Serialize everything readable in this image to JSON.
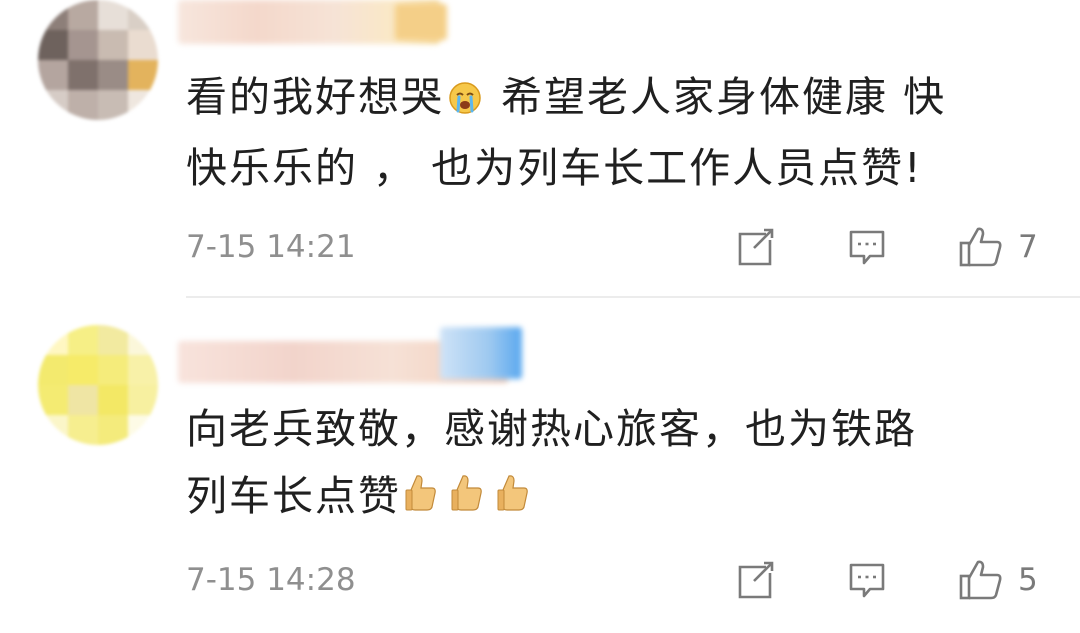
{
  "comments": [
    {
      "text_lines": [
        "看的我好想哭",
        " 希望老人家身体健康 快",
        "快乐乐的 ， 也为列车长工作人员点赞!"
      ],
      "emoji": "crying-face",
      "timestamp": "7-15 14:21",
      "likes": "7"
    },
    {
      "text_lines": [
        "向老兵致敬，感谢热心旅客，也为铁路",
        "列车长点赞"
      ],
      "emoji": "thumbs-up x3",
      "timestamp": "7-15 14:28",
      "likes": "5"
    }
  ],
  "icons": {
    "repost": "repost-icon",
    "reply": "comment-icon",
    "like": "thumbs-up-icon"
  },
  "colors": {
    "text": "#202020",
    "meta": "#8f8f8f",
    "icon": "#7a7a7a",
    "divider": "#ececec"
  }
}
